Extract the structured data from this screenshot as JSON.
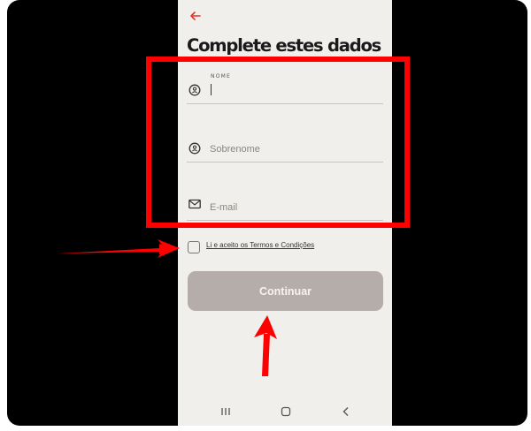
{
  "screen": {
    "title": "Complete estes dados"
  },
  "form": {
    "nome": {
      "label": "NOME",
      "value": ""
    },
    "sobrenome": {
      "placeholder": "Sobrenome"
    },
    "email": {
      "placeholder": "E-mail"
    }
  },
  "terms": {
    "label": "Li e aceito os Termos e Condições",
    "checked": false
  },
  "actions": {
    "continue_label": "Continuar"
  },
  "icons": {
    "back": "arrow-left-icon",
    "nome": "user-circle-icon",
    "sobrenome": "user-circle-icon",
    "email": "envelope-icon",
    "nav_recent": "recent-apps-icon",
    "nav_home": "home-icon",
    "nav_back": "chevron-left-icon"
  },
  "colors": {
    "accent": "#e0362b",
    "annotation": "#ff0000",
    "screen_background": "#f1efec",
    "button_disabled": "#b5adaa"
  }
}
